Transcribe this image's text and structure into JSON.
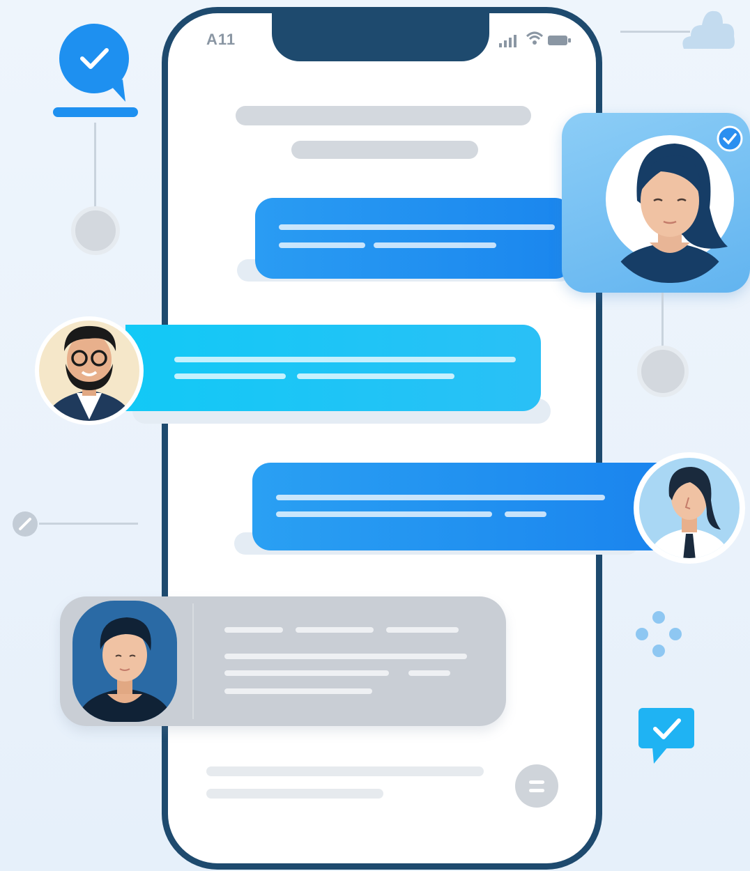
{
  "status_bar": {
    "carrier": "A11",
    "icons": [
      "signal-icon",
      "wifi-icon",
      "battery-icon"
    ]
  },
  "colors": {
    "phone_frame": "#1e4a6e",
    "bubble_blue": "#1f8ef1",
    "bubble_cyan": "#19c3f5",
    "bubble_grey": "#c9ced5",
    "background": "#eef5fc"
  },
  "icons": {
    "top_left": "chat-check-icon",
    "top_right": "cloud-icon",
    "bottom_right": "chat-check-icon",
    "left_mid": "pencil-icon",
    "right_mid": "dots-icon",
    "bottom_button": "menu-icon"
  }
}
